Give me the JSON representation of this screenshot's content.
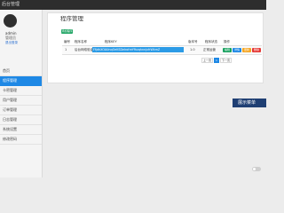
{
  "app": {
    "title": "后台管理"
  },
  "user": {
    "name": "admin",
    "role": "管理员",
    "logout_label": "退出登录"
  },
  "sidebar": {
    "items": [
      {
        "label": "首页",
        "active": false
      },
      {
        "label": "程序管理",
        "active": true
      },
      {
        "label": "卡密管理",
        "active": false
      },
      {
        "label": "用户管理",
        "active": false
      },
      {
        "label": "订单管理",
        "active": false
      },
      {
        "label": "日志管理",
        "active": false
      },
      {
        "label": "系统设置",
        "active": false
      },
      {
        "label": "修改密码",
        "active": false
      }
    ]
  },
  "page": {
    "title": "程序管理",
    "add_button_label": "添加程序"
  },
  "table": {
    "headers": [
      "编号",
      "程序名称",
      "程序KEY",
      "版本号",
      "程序状态",
      "操作"
    ],
    "rows": [
      {
        "id": "1",
        "name": "后台网络验证示例程序",
        "key": "FfjdhXOAUnqOeKSDeIrofreYfhzqhnnjxfrWkmZ",
        "version": "1.0",
        "status": "正常运营",
        "actions": [
          "编辑",
          "详情",
          "更新",
          "删除"
        ]
      }
    ]
  },
  "pagination": {
    "prev": "上一页",
    "current": "1",
    "next": "下一页"
  },
  "banner": {
    "text": "展示菜单"
  },
  "colors": {
    "accent": "#1e88e5",
    "add": "#1aa260",
    "action_edit": "#1aa260",
    "action_detail": "#1e88e5",
    "action_update": "#f5a623",
    "action_delete": "#e53935"
  }
}
